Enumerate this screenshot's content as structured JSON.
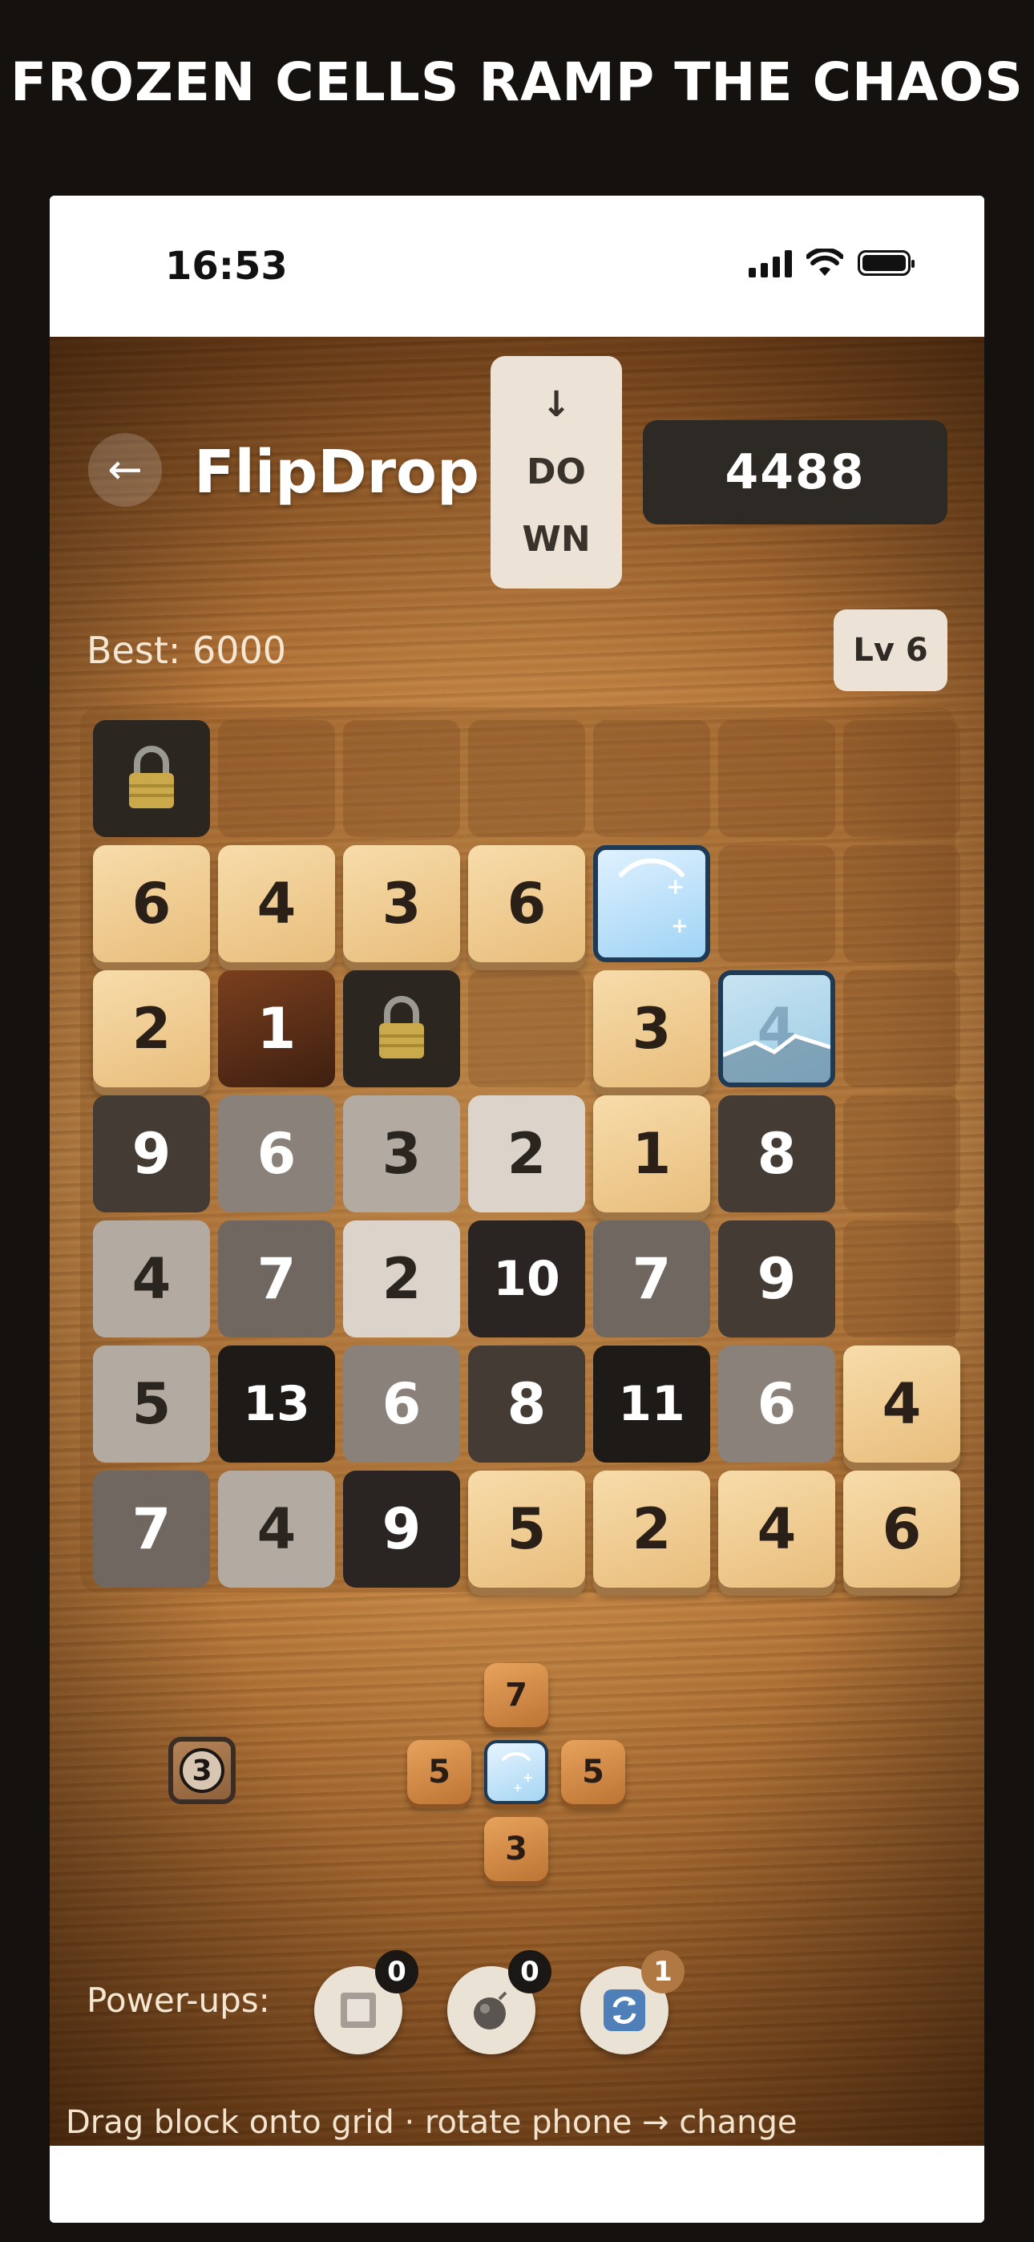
{
  "headline": "FROZEN CELLS RAMP THE CHAOS",
  "status": {
    "time": "16:53"
  },
  "header": {
    "back_icon": "arrow-left-icon",
    "title": "FlipDrop",
    "direction": {
      "arrow": "↓",
      "line1": "DO",
      "line2": "WN"
    },
    "score": "4488"
  },
  "stats": {
    "best": "Best: 6000",
    "level": "Lv 6"
  },
  "board": {
    "rows": [
      [
        {
          "k": "lock"
        },
        {
          "k": "slot"
        },
        {
          "k": "slot"
        },
        {
          "k": "slot"
        },
        {
          "k": "slot"
        },
        {
          "k": "slot"
        },
        {
          "k": "slot"
        }
      ],
      [
        {
          "k": "tan",
          "v": "6"
        },
        {
          "k": "tan",
          "v": "4"
        },
        {
          "k": "tan",
          "v": "3"
        },
        {
          "k": "tan",
          "v": "6"
        },
        {
          "k": "ice"
        },
        {
          "k": "slot"
        },
        {
          "k": "slot"
        }
      ],
      [
        {
          "k": "tan",
          "v": "2"
        },
        {
          "k": "wood",
          "v": "1"
        },
        {
          "k": "lock"
        },
        {
          "k": "slot"
        },
        {
          "k": "tan",
          "v": "3"
        },
        {
          "k": "ice-cracked",
          "v": "4"
        },
        {
          "k": "slot"
        }
      ],
      [
        {
          "k": "dark",
          "v": "9"
        },
        {
          "k": "gray",
          "v": "6"
        },
        {
          "k": "light",
          "v": "3"
        },
        {
          "k": "pale",
          "v": "2"
        },
        {
          "k": "tan",
          "v": "1"
        },
        {
          "k": "dark",
          "v": "8"
        },
        {
          "k": "slot"
        }
      ],
      [
        {
          "k": "light",
          "v": "4"
        },
        {
          "k": "mid",
          "v": "7"
        },
        {
          "k": "pale",
          "v": "2"
        },
        {
          "k": "darker",
          "v": "10"
        },
        {
          "k": "mid",
          "v": "7"
        },
        {
          "k": "dark",
          "v": "9"
        },
        {
          "k": "slot"
        }
      ],
      [
        {
          "k": "light",
          "v": "5"
        },
        {
          "k": "black",
          "v": "13"
        },
        {
          "k": "gray",
          "v": "6"
        },
        {
          "k": "dark",
          "v": "8"
        },
        {
          "k": "black",
          "v": "11"
        },
        {
          "k": "gray",
          "v": "6"
        },
        {
          "k": "tan",
          "v": "4"
        }
      ],
      [
        {
          "k": "mid",
          "v": "7"
        },
        {
          "k": "light",
          "v": "4"
        },
        {
          "k": "darker",
          "v": "9"
        },
        {
          "k": "tan",
          "v": "5"
        },
        {
          "k": "tan",
          "v": "2"
        },
        {
          "k": "tan",
          "v": "4"
        },
        {
          "k": "tan",
          "v": "6"
        }
      ]
    ]
  },
  "next_piece": {
    "top": "7",
    "left": "5",
    "center_icon": "ice-icon",
    "right": "5",
    "bottom": "3"
  },
  "frozen_counter": "3",
  "powerups": {
    "label": "Power-ups:",
    "items": [
      {
        "icon": "square-icon",
        "count": "0"
      },
      {
        "icon": "bomb-icon",
        "count": "0"
      },
      {
        "icon": "rotate-icon",
        "count": "1"
      }
    ]
  },
  "hint": "Drag block onto grid · rotate phone → change"
}
